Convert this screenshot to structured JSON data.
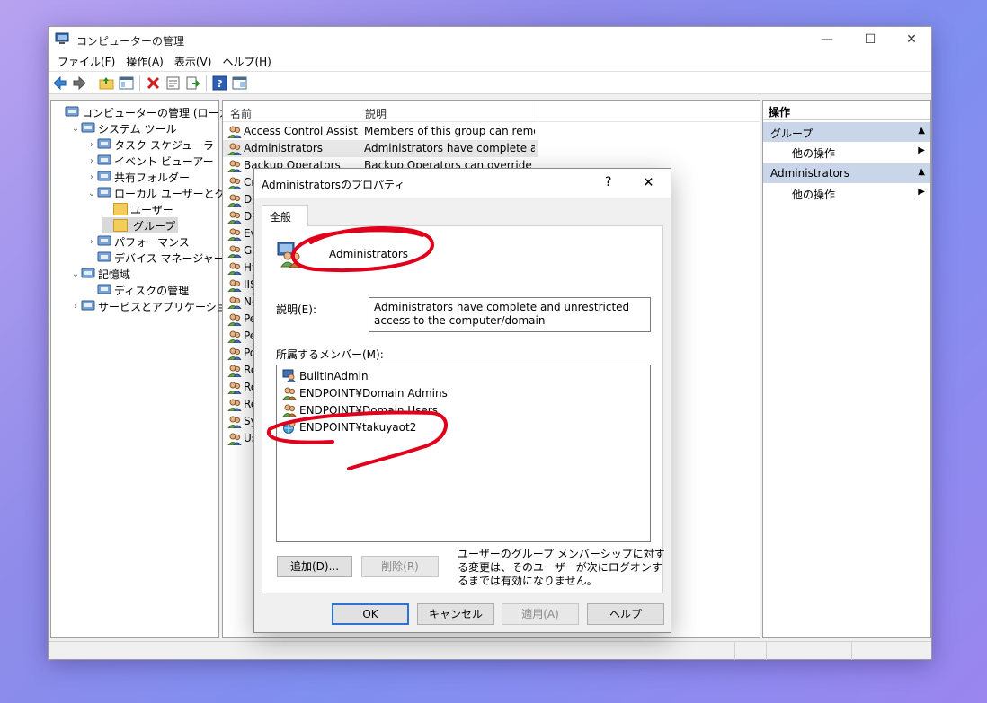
{
  "window": {
    "title": "コンピューターの管理",
    "minimize": "—",
    "maximize": "☐",
    "close": "✕"
  },
  "menu": [
    "ファイル(F)",
    "操作(A)",
    "表示(V)",
    "ヘルプ(H)"
  ],
  "tree": [
    {
      "label": "コンピューターの管理 (ローカル)",
      "level": 0,
      "chevron": "",
      "icon": "computer-management-icon"
    },
    {
      "label": "システム ツール",
      "level": 1,
      "chevron": "⌄",
      "icon": "tools-icon"
    },
    {
      "label": "タスク スケジューラ",
      "level": 2,
      "chevron": "›",
      "icon": "clock-icon"
    },
    {
      "label": "イベント ビューアー",
      "level": 2,
      "chevron": "›",
      "icon": "event-viewer-icon"
    },
    {
      "label": "共有フォルダー",
      "level": 2,
      "chevron": "›",
      "icon": "shared-folder-icon"
    },
    {
      "label": "ローカル ユーザーとグループ",
      "level": 2,
      "chevron": "⌄",
      "icon": "users-groups-icon"
    },
    {
      "label": "ユーザー",
      "level": 3,
      "chevron": "",
      "icon": "folder-icon"
    },
    {
      "label": "グループ",
      "level": 3,
      "chevron": "",
      "icon": "folder-icon",
      "selected": true
    },
    {
      "label": "パフォーマンス",
      "level": 2,
      "chevron": "›",
      "icon": "performance-icon"
    },
    {
      "label": "デバイス マネージャー",
      "level": 2,
      "chevron": "",
      "icon": "device-manager-icon"
    },
    {
      "label": "記憶域",
      "level": 1,
      "chevron": "⌄",
      "icon": "storage-icon"
    },
    {
      "label": "ディスクの管理",
      "level": 2,
      "chevron": "",
      "icon": "disk-icon"
    },
    {
      "label": "サービスとアプリケーション",
      "level": 1,
      "chevron": "›",
      "icon": "services-icon"
    }
  ],
  "list": {
    "col_name": "名前",
    "col_desc": "説明",
    "rows": [
      {
        "name": "Access Control Assista...",
        "desc": "Members of this group can remot..."
      },
      {
        "name": "Administrators",
        "desc": "Administrators have complete an...",
        "selected": true
      },
      {
        "name": "Backup Operators",
        "desc": "Backup Operators can override se..."
      },
      {
        "name": "Cr",
        "desc": ""
      },
      {
        "name": "De",
        "desc": ""
      },
      {
        "name": "Dis",
        "desc": ""
      },
      {
        "name": "Ev",
        "desc": ""
      },
      {
        "name": "Gu",
        "desc": ""
      },
      {
        "name": "Hy",
        "desc": ""
      },
      {
        "name": "IIS",
        "desc": ""
      },
      {
        "name": "Ne",
        "desc": ""
      },
      {
        "name": "Pe",
        "desc": ""
      },
      {
        "name": "Pe",
        "desc": ""
      },
      {
        "name": "Po",
        "desc": ""
      },
      {
        "name": "Re",
        "desc": ""
      },
      {
        "name": "Re",
        "desc": ""
      },
      {
        "name": "Re",
        "desc": ""
      },
      {
        "name": "Sy",
        "desc": ""
      },
      {
        "name": "Us",
        "desc": ""
      }
    ]
  },
  "actions": {
    "header": "操作",
    "sections": [
      {
        "title": "グループ",
        "item": "他の操作"
      },
      {
        "title": "Administrators",
        "item": "他の操作"
      }
    ],
    "collapse_glyph": "▲",
    "more_glyph": "▶"
  },
  "dialog": {
    "title": "Administratorsのプロパティ",
    "help": "?",
    "close": "✕",
    "tab": "全般",
    "group_name": "Administrators",
    "desc_label": "説明(E):",
    "desc_value": "Administrators have complete and unrestricted access to the computer/domain",
    "members_label": "所属するメンバー(M):",
    "members": [
      {
        "name": "BuiltInAdmin",
        "icon": "user-icon"
      },
      {
        "name": "ENDPOINT¥Domain Admins",
        "icon": "group-icon"
      },
      {
        "name": "ENDPOINT¥Domain Users",
        "icon": "group-icon"
      },
      {
        "name": "ENDPOINT¥takuyaot2",
        "icon": "user-globe-icon"
      }
    ],
    "add_button": "追加(D)...",
    "remove_button": "削除(R)",
    "note": "ユーザーのグループ メンバーシップに対する変更は、そのユーザーが次にログオンするまでは有効になりません。",
    "ok": "OK",
    "cancel": "キャンセル",
    "apply": "適用(A)",
    "help_button": "ヘルプ"
  },
  "colors": {
    "accent_blue": "#2c73d2",
    "selection": "#c9d6ea",
    "annotation_red": "#e0001b"
  }
}
